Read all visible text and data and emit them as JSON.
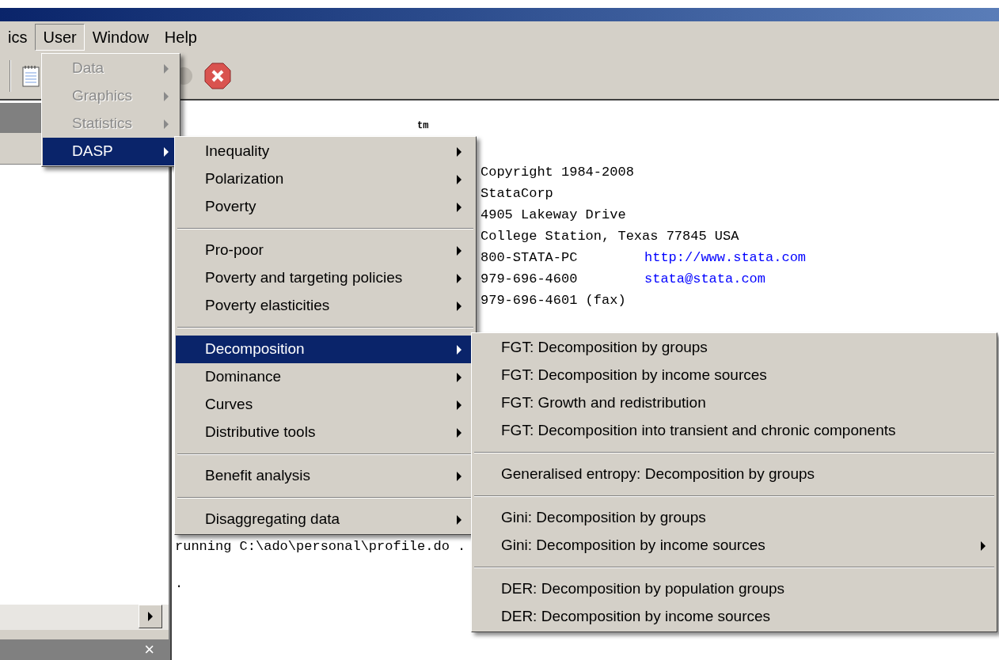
{
  "menubar": [
    {
      "label": "ics",
      "selected": false
    },
    {
      "label": "User",
      "selected": true
    },
    {
      "label": "Window",
      "selected": false
    },
    {
      "label": "Help",
      "selected": false
    }
  ],
  "menus": [
    {
      "groups": [
        [
          {
            "label": "Data",
            "submenu": true,
            "disabled": true,
            "selected": false
          },
          {
            "label": "Graphics",
            "submenu": true,
            "disabled": true,
            "selected": false
          },
          {
            "label": "Statistics",
            "submenu": true,
            "disabled": true,
            "selected": false
          },
          {
            "label": "DASP",
            "submenu": true,
            "disabled": false,
            "selected": true
          }
        ]
      ]
    },
    {
      "groups": [
        [
          {
            "label": "Inequality",
            "submenu": true,
            "disabled": false,
            "selected": false
          },
          {
            "label": "Polarization",
            "submenu": true,
            "disabled": false,
            "selected": false
          },
          {
            "label": "Poverty",
            "submenu": true,
            "disabled": false,
            "selected": false
          }
        ],
        [
          {
            "label": "Pro-poor",
            "submenu": true,
            "disabled": false,
            "selected": false
          },
          {
            "label": "Poverty and targeting policies",
            "submenu": true,
            "disabled": false,
            "selected": false
          },
          {
            "label": "Poverty elasticities",
            "submenu": true,
            "disabled": false,
            "selected": false
          }
        ],
        [
          {
            "label": "Decomposition",
            "submenu": true,
            "disabled": false,
            "selected": true
          },
          {
            "label": "Dominance",
            "submenu": true,
            "disabled": false,
            "selected": false
          },
          {
            "label": "Curves",
            "submenu": true,
            "disabled": false,
            "selected": false
          },
          {
            "label": "Distributive tools",
            "submenu": true,
            "disabled": false,
            "selected": false
          }
        ],
        [
          {
            "label": "Benefit analysis",
            "submenu": true,
            "disabled": false,
            "selected": false
          }
        ],
        [
          {
            "label": "Disaggregating data",
            "submenu": true,
            "disabled": false,
            "selected": false
          }
        ]
      ]
    },
    {
      "groups": [
        [
          {
            "label": "FGT: Decomposition by groups",
            "submenu": false,
            "disabled": false,
            "selected": false
          },
          {
            "label": "FGT: Decomposition by income sources",
            "submenu": false,
            "disabled": false,
            "selected": false
          },
          {
            "label": "FGT: Growth and redistribution",
            "submenu": false,
            "disabled": false,
            "selected": false
          },
          {
            "label": "FGT: Decomposition into transient and chronic components",
            "submenu": false,
            "disabled": false,
            "selected": false
          }
        ],
        [
          {
            "label": "Generalised entropy: Decomposition by groups",
            "submenu": false,
            "disabled": false,
            "selected": false
          }
        ],
        [
          {
            "label": "Gini: Decomposition by groups",
            "submenu": false,
            "disabled": false,
            "selected": false
          },
          {
            "label": "Gini: Decomposition by income sources",
            "submenu": true,
            "disabled": false,
            "selected": false
          }
        ],
        [
          {
            "label": "DER: Decomposition by population groups",
            "submenu": false,
            "disabled": false,
            "selected": false
          },
          {
            "label": "DER: Decomposition by income sources",
            "submenu": false,
            "disabled": false,
            "selected": false
          }
        ]
      ]
    }
  ],
  "results": {
    "trademark": "tm",
    "lines": [
      {
        "text": "Copyright 1984-2008"
      },
      {
        "text": "StataCorp"
      },
      {
        "text": "4905 Lakeway Drive"
      },
      {
        "text": "College Station, Texas 77845 USA"
      },
      {
        "text": "800-STATA-PC",
        "link": "http://www.stata.com"
      },
      {
        "text": "979-696-4600",
        "link": "stata@stata.com"
      },
      {
        "text": "979-696-4601 (fax)"
      }
    ],
    "running": "running C:\\ado\\personal\\profile.do .",
    "prompt": "."
  },
  "panel": {
    "close": "×"
  }
}
